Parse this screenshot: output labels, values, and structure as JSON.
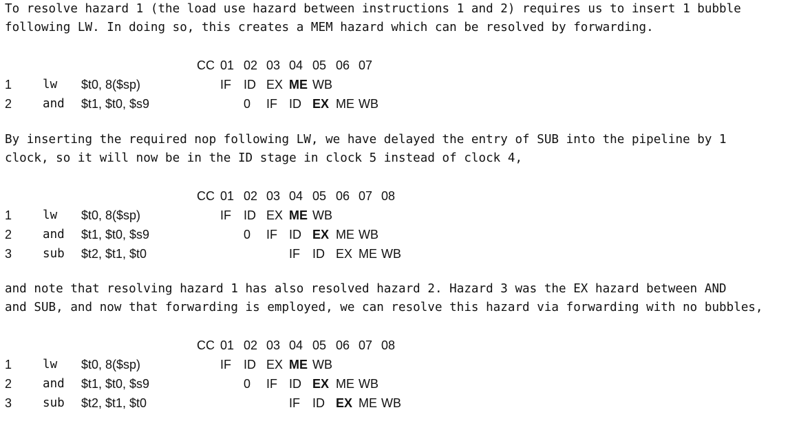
{
  "paragraphs": [
    {
      "line1": "To resolve hazard 1 (the load use hazard between instructions 1 and 2) requires us to insert 1 bubble",
      "line2": "following LW. In doing so, this creates a MEM hazard which can be resolved by forwarding."
    },
    {
      "line1": "By inserting the required nop following LW, we have delayed the entry of SUB into the pipeline by 1",
      "line2": "clock, so it will now be in the ID stage in clock 5 instead of clock 4,"
    },
    {
      "line1": "and note that resolving hazard 1 has also resolved hazard 2. Hazard 3 was the EX hazard between AND",
      "line2": "and SUB, and now that forwarding is employed, we can resolve this hazard via forwarding with no bubbles,"
    }
  ],
  "tables": [
    {
      "header": [
        "CC",
        "01",
        "02",
        "03",
        "04",
        "05",
        "06",
        "07"
      ],
      "rows": [
        {
          "num": "1",
          "op": "lw",
          "args": "$t0, 8($sp)",
          "stages": [
            {
              "text": "IF",
              "col": 1,
              "bold": false
            },
            {
              "text": "ID",
              "col": 2,
              "bold": false
            },
            {
              "text": "EX",
              "col": 3,
              "bold": false
            },
            {
              "text": "ME",
              "col": 4,
              "bold": true
            },
            {
              "text": "WB",
              "col": 5,
              "bold": false
            }
          ]
        },
        {
          "num": "2",
          "op": "and",
          "args": "$t1, $t0, $s9",
          "stages": [
            {
              "text": "0",
              "col": 2,
              "bold": false
            },
            {
              "text": "IF",
              "col": 3,
              "bold": false
            },
            {
              "text": "ID",
              "col": 4,
              "bold": false
            },
            {
              "text": "EX",
              "col": 5,
              "bold": true
            },
            {
              "text": "ME",
              "col": 6,
              "bold": false
            },
            {
              "text": "WB",
              "col": 7,
              "bold": false
            }
          ]
        }
      ]
    },
    {
      "header": [
        "CC",
        "01",
        "02",
        "03",
        "04",
        "05",
        "06",
        "07",
        "08"
      ],
      "rows": [
        {
          "num": "1",
          "op": "lw",
          "args": "$t0, 8($sp)",
          "stages": [
            {
              "text": "IF",
              "col": 1,
              "bold": false
            },
            {
              "text": "ID",
              "col": 2,
              "bold": false
            },
            {
              "text": "EX",
              "col": 3,
              "bold": false
            },
            {
              "text": "ME",
              "col": 4,
              "bold": true
            },
            {
              "text": "WB",
              "col": 5,
              "bold": false
            }
          ]
        },
        {
          "num": "2",
          "op": "and",
          "args": "$t1, $t0, $s9",
          "stages": [
            {
              "text": "0",
              "col": 2,
              "bold": false
            },
            {
              "text": "IF",
              "col": 3,
              "bold": false
            },
            {
              "text": "ID",
              "col": 4,
              "bold": false
            },
            {
              "text": "EX",
              "col": 5,
              "bold": true
            },
            {
              "text": "ME",
              "col": 6,
              "bold": false
            },
            {
              "text": "WB",
              "col": 7,
              "bold": false
            }
          ]
        },
        {
          "num": "3",
          "op": "sub",
          "args": "$t2, $t1, $t0",
          "stages": [
            {
              "text": "IF",
              "col": 4,
              "bold": false
            },
            {
              "text": "ID",
              "col": 5,
              "bold": false
            },
            {
              "text": "EX",
              "col": 6,
              "bold": false
            },
            {
              "text": "ME",
              "col": 7,
              "bold": false
            },
            {
              "text": "WB",
              "col": 8,
              "bold": false
            }
          ]
        }
      ]
    },
    {
      "header": [
        "CC",
        "01",
        "02",
        "03",
        "04",
        "05",
        "06",
        "07",
        "08"
      ],
      "rows": [
        {
          "num": "1",
          "op": "lw",
          "args": "$t0, 8($sp)",
          "stages": [
            {
              "text": "IF",
              "col": 1,
              "bold": false
            },
            {
              "text": "ID",
              "col": 2,
              "bold": false
            },
            {
              "text": "EX",
              "col": 3,
              "bold": false
            },
            {
              "text": "ME",
              "col": 4,
              "bold": true
            },
            {
              "text": "WB",
              "col": 5,
              "bold": false
            }
          ]
        },
        {
          "num": "2",
          "op": "and",
          "args": "$t1, $t0, $s9",
          "stages": [
            {
              "text": "0",
              "col": 2,
              "bold": false
            },
            {
              "text": "IF",
              "col": 3,
              "bold": false
            },
            {
              "text": "ID",
              "col": 4,
              "bold": false
            },
            {
              "text": "EX",
              "col": 5,
              "bold": true
            },
            {
              "text": "ME",
              "col": 6,
              "bold": false
            },
            {
              "text": "WB",
              "col": 7,
              "bold": false
            }
          ]
        },
        {
          "num": "3",
          "op": "sub",
          "args": "$t2, $t1, $t0",
          "stages": [
            {
              "text": "IF",
              "col": 4,
              "bold": false
            },
            {
              "text": "ID",
              "col": 5,
              "bold": false
            },
            {
              "text": "EX",
              "col": 6,
              "bold": true
            },
            {
              "text": "ME",
              "col": 7,
              "bold": false
            },
            {
              "text": "WB",
              "col": 8,
              "bold": false
            }
          ]
        }
      ]
    }
  ]
}
